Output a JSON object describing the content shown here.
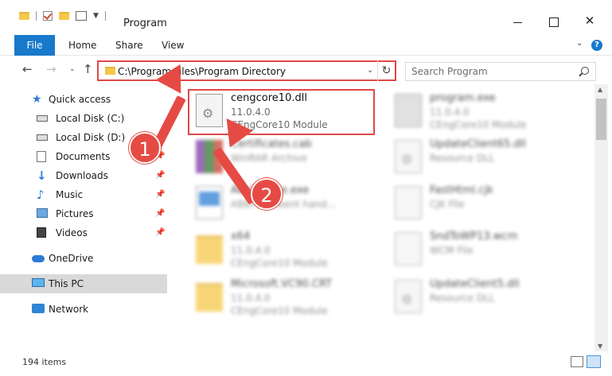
{
  "window": {
    "title": "Program",
    "controls": {
      "minimize": "—",
      "maximize": "☐",
      "close": "✕"
    }
  },
  "ribbon": {
    "file": "File",
    "tabs": [
      "Home",
      "Share",
      "View"
    ]
  },
  "address": {
    "path": "C:\\Program Files\\Program Directory",
    "refresh": "↻"
  },
  "search": {
    "placeholder": "Search Program"
  },
  "sidebar": {
    "items": [
      {
        "label": "Quick access",
        "icon": "star-icon",
        "pinned": false
      },
      {
        "label": "Local Disk (C:)",
        "icon": "disk-icon",
        "pinned": false
      },
      {
        "label": "Local Disk (D:)",
        "icon": "disk-icon",
        "pinned": false
      },
      {
        "label": "Documents",
        "icon": "documents-icon",
        "pinned": true
      },
      {
        "label": "Downloads",
        "icon": "downloads-icon",
        "pinned": true
      },
      {
        "label": "Music",
        "icon": "music-icon",
        "pinned": true
      },
      {
        "label": "Pictures",
        "icon": "pictures-icon",
        "pinned": true
      },
      {
        "label": "Videos",
        "icon": "videos-icon",
        "pinned": true
      },
      {
        "label": "OneDrive",
        "icon": "onedrive-icon",
        "pinned": false
      },
      {
        "label": "This PC",
        "icon": "this-pc-icon",
        "pinned": false,
        "selected": true
      },
      {
        "label": "Network",
        "icon": "network-icon",
        "pinned": false
      }
    ]
  },
  "files": [
    {
      "name": "cengcore10.dll",
      "version": "11.0.4.0",
      "description": "CEngCore10 Module",
      "icon": "dll-gear-icon",
      "highlighted": true
    },
    {
      "name": "program.exe",
      "version": "11.0.4.0",
      "description": "CEngCore10 Module",
      "icon": "exe-icon"
    },
    {
      "name": "Certificates.cab",
      "version": "",
      "description": "WinRAR Archive",
      "icon": "winrar-icon"
    },
    {
      "name": "UpdateClient65.dll",
      "version": "",
      "description": "Resource DLL",
      "icon": "dll-icon"
    },
    {
      "name": "AbsUpdate.exe",
      "version": "",
      "description": "ABBYY Fineent hand...",
      "icon": "app-icon"
    },
    {
      "name": "FastHtml.cjk",
      "version": "",
      "description": "CJK File",
      "icon": "file-icon"
    },
    {
      "name": "x64",
      "version": "11.0.4.0",
      "description": "CEngCore10 Module",
      "icon": "folder-icon"
    },
    {
      "name": "SndToWP13.wcm",
      "version": "",
      "description": "WCM File",
      "icon": "file-icon"
    },
    {
      "name": "Microsoft.VC90.CRT",
      "version": "11.0.4.0",
      "description": "CEngCore10 Module",
      "icon": "folder-icon"
    },
    {
      "name": "UpdateClient5.dll",
      "version": "",
      "description": "Resource DLL",
      "icon": "dll-icon"
    }
  ],
  "status": {
    "items": "194 items"
  },
  "annotations": {
    "step1": "1",
    "step2": "2",
    "color": "#e54b44"
  }
}
